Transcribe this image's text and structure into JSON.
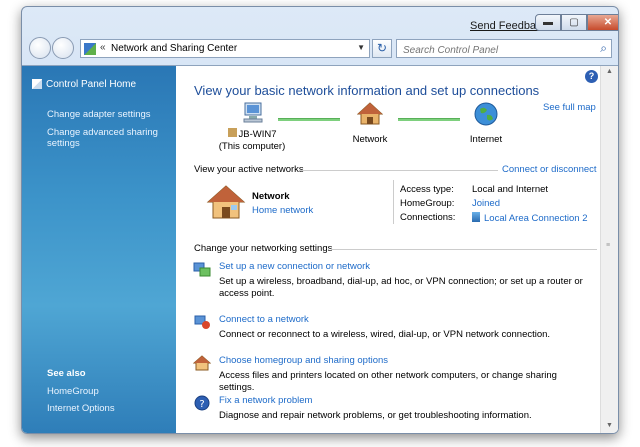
{
  "titlebar": {
    "send_feedback": "Send Feedback",
    "min": "▬",
    "max": "▢",
    "close": "✕"
  },
  "address": {
    "chevron": "«",
    "path": "Network and Sharing Center",
    "dropdown": "▼",
    "refresh": "↻"
  },
  "search": {
    "placeholder": "Search Control Panel",
    "icon": "⌕"
  },
  "sidebar": {
    "home": "Control Panel Home",
    "links": [
      "Change adapter settings",
      "Change advanced sharing settings"
    ],
    "see_also_title": "See also",
    "see_also": [
      "HomeGroup",
      "Internet Options"
    ]
  },
  "main": {
    "help": "?",
    "heading": "View your basic network information and set up connections",
    "see_full_map": "See full map",
    "map": {
      "computer_name": "JB-WIN7",
      "computer_sub": "(This computer)",
      "network": "Network",
      "internet": "Internet"
    },
    "active_title": "View your active networks",
    "connect_disconnect": "Connect or disconnect",
    "active": {
      "name": "Network",
      "type": "Home network",
      "access_type_label": "Access type:",
      "access_type": "Local and Internet",
      "homegroup_label": "HomeGroup:",
      "homegroup": "Joined",
      "connections_label": "Connections:",
      "connection": "Local Area Connection 2"
    },
    "change_title": "Change your networking settings",
    "tasks": [
      {
        "title": "Set up a new connection or network",
        "desc": "Set up a wireless, broadband, dial-up, ad hoc, or VPN connection; or set up a router or access point."
      },
      {
        "title": "Connect to a network",
        "desc": "Connect or reconnect to a wireless, wired, dial-up, or VPN network connection."
      },
      {
        "title": "Choose homegroup and sharing options",
        "desc": "Access files and printers located on other network computers, or change sharing settings."
      },
      {
        "title": "Fix a network problem",
        "desc": "Diagnose and repair network problems, or get troubleshooting information."
      }
    ]
  }
}
